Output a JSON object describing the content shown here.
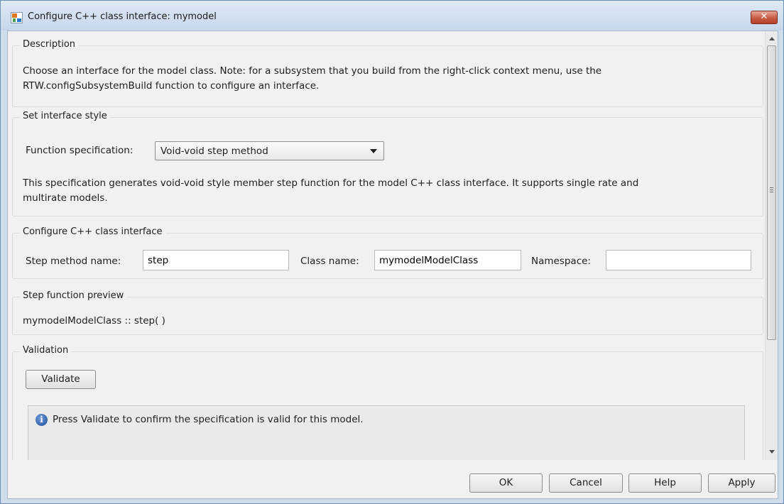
{
  "window": {
    "title": "Configure C++ class interface: mymodel",
    "close_glyph": "✕"
  },
  "description": {
    "title": "Description",
    "text_line1": "Choose an interface for the model class. Note: for a subsystem that you build from the right-click context menu, use the",
    "text_line2": "RTW.configSubsystemBuild function to configure an interface."
  },
  "interface_style": {
    "title": "Set interface style",
    "function_spec_label": "Function specification:",
    "function_spec_value": "Void-void step method",
    "info_line1": "This specification generates void-void style member step function for the model C++ class interface. It supports single rate and",
    "info_line2": "multirate models."
  },
  "class_interface": {
    "title": "Configure C++ class interface",
    "step_method_label": "Step method name:",
    "step_method_value": "step",
    "class_name_label": "Class name:",
    "class_name_value": "mymodelModelClass",
    "namespace_label": "Namespace:",
    "namespace_value": ""
  },
  "preview": {
    "title": "Step function preview",
    "text": "mymodelModelClass :: step( )"
  },
  "validation": {
    "title": "Validation",
    "button_label": "Validate",
    "info_icon_glyph": "i",
    "message": "Press Validate to confirm the specification is valid for this model."
  },
  "footer": {
    "ok_label": "OK",
    "cancel_label": "Cancel",
    "help_label": "Help",
    "apply_label": "Apply"
  }
}
